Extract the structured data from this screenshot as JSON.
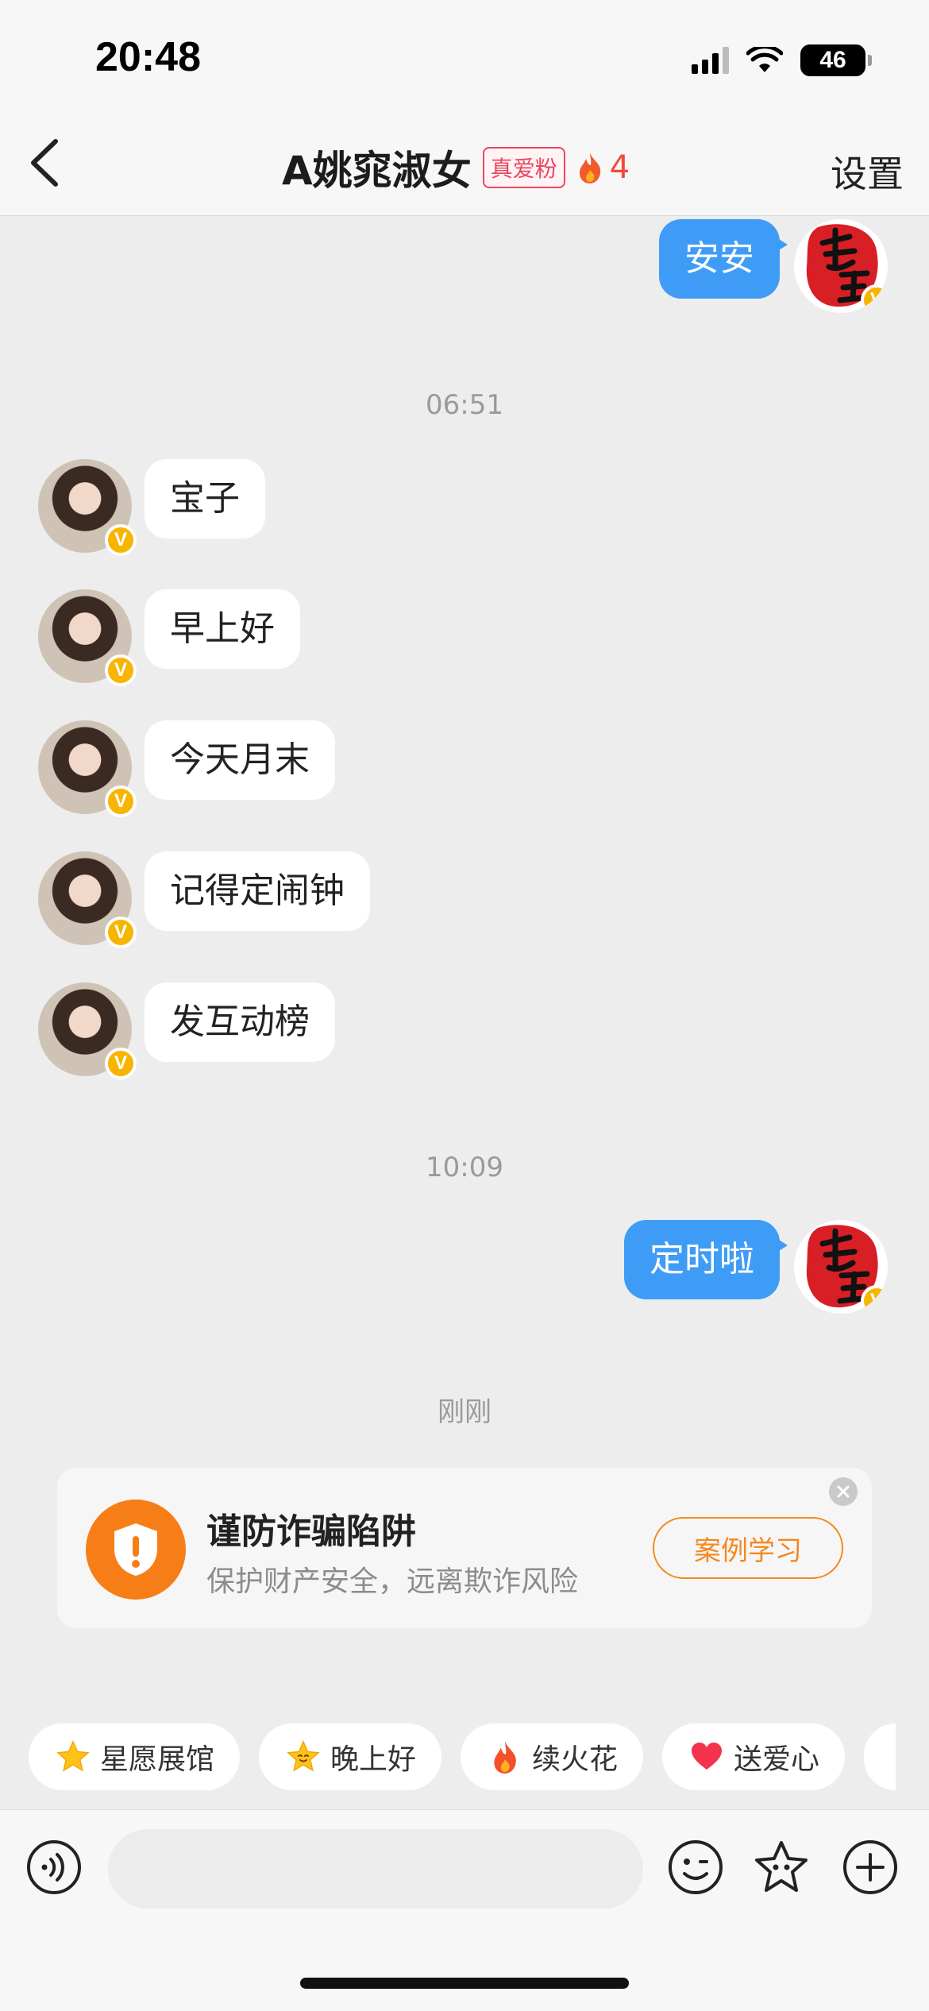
{
  "status_bar": {
    "time": "20:48",
    "battery": "46"
  },
  "header": {
    "title": "A姚窕淑女",
    "fan_badge": "真爱粉",
    "fire_count": "4",
    "settings_label": "设置"
  },
  "messages": {
    "out_1": "安安",
    "time_1": "06:51",
    "in_1": "宝子",
    "in_2": "早上好",
    "in_3": "今天月末",
    "in_4": "记得定闹钟",
    "in_5": "发互动榜",
    "time_2": "10:09",
    "out_2": "定时啦",
    "time_3": "刚刚"
  },
  "avatar_badge": "V",
  "fraud_card": {
    "title": "谨防诈骗陷阱",
    "subtitle": "保护财产安全，远离欺诈风险",
    "button": "案例学习"
  },
  "quick_replies": [
    {
      "label": "星愿展馆",
      "icon": "star-icon"
    },
    {
      "label": "晚上好",
      "icon": "star-face-icon"
    },
    {
      "label": "续火花",
      "icon": "fire-icon"
    },
    {
      "label": "送爱心",
      "icon": "heart-icon"
    }
  ],
  "colors": {
    "accent_blue": "#3f9cf6",
    "orange": "#f77e16",
    "fan_red": "#e8475f"
  }
}
